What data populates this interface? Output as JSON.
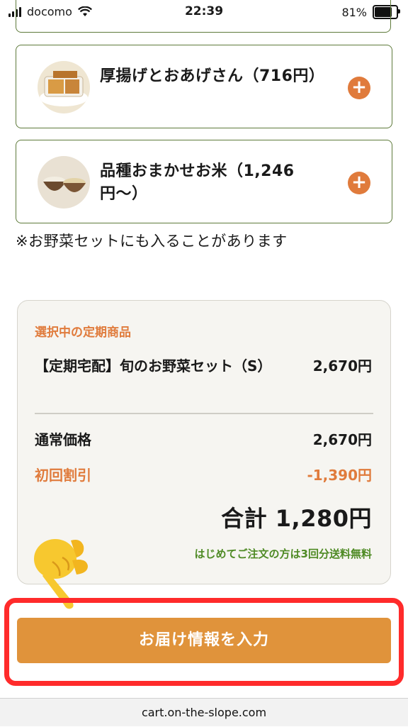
{
  "status_bar": {
    "carrier": "docomo",
    "time": "22:39",
    "battery_percent": "81%",
    "battery_level": 0.81
  },
  "items": [
    {
      "name": "厚揚げとおあげさん（716円）",
      "add_icon": "plus-icon",
      "thumb_icon": "fried-tofu-icon"
    },
    {
      "name": "品種おまかせお米（1,246円〜）",
      "add_icon": "plus-icon",
      "thumb_icon": "rice-bowl-icon"
    }
  ],
  "note": "※お野菜セットにも入ることがあります",
  "summary": {
    "section_label": "選択中の定期商品",
    "product_name": "【定期宅配】旬のお野菜セット（S）",
    "product_price": "2,670円",
    "regular_label": "通常価格",
    "regular_value": "2,670円",
    "discount_label": "初回割引",
    "discount_value": "-1,390円",
    "total": "合計 1,280円",
    "shipping_note": "はじめてご注文の方は3回分送料無料"
  },
  "cta": {
    "label": "お届け情報を入力"
  },
  "pointer_icon": "pointing-hand-icon",
  "url": "cart.on-the-slope.com",
  "colors": {
    "card_border": "#5e7a3a",
    "accent_orange": "#e07b3c",
    "cta_bg": "#e0933b",
    "green_note": "#4e8a24",
    "highlight_red": "#ff2b2b"
  }
}
